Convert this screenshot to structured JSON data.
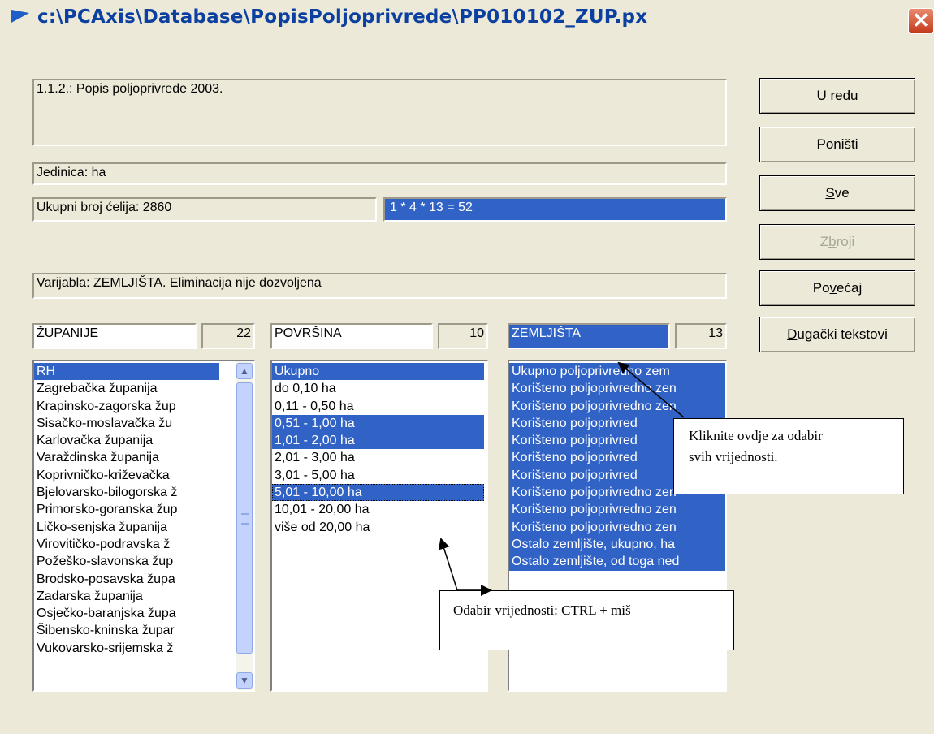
{
  "window": {
    "title": "c:\\PCAxis\\Database\\PopisPoljoprivrede\\PP010102_ZUP.px",
    "close_symbol": "✕",
    "title_icon": "arrow-icon"
  },
  "info": {
    "description": "1.1.2.: Popis poljoprivrede  2003.",
    "unit": "Jedinica: ha",
    "total_cells": "Ukupni broj ćelija:  2860",
    "selection_formula": "1 * 4 * 13 = 52",
    "variable_info": "Varijabla: ZEMLJIŠTA. Eliminacija nije dozvoljena"
  },
  "buttons": {
    "ok": "U redu",
    "cancel": "Poništi",
    "all_prefix": "",
    "all_underline": "S",
    "all_rest": "ve",
    "sum_prefix": "Z",
    "sum_underline": "b",
    "sum_rest": "roji",
    "enlarge_prefix": "Po",
    "enlarge_underline": "v",
    "enlarge_rest": "ećaj",
    "long_prefix": "",
    "long_underline": "D",
    "long_rest": "ugački tekstovi"
  },
  "variables": [
    {
      "name": "ŽUPANIJE",
      "count": "22",
      "values": [
        "RH",
        "Zagrebačka županija",
        "Krapinsko-zagorska žup",
        "Sisačko-moslavačka žu",
        "Karlovačka  županija",
        "Varaždinska županija",
        "Koprivničko-križevačka",
        "Bjelovarsko-bilogorska ž",
        "Primorsko-goranska žup",
        "Ličko-senjska županija",
        "Virovitičko-podravska ž",
        "Požeško-slavonska  žup",
        "Brodsko-posavska  župa",
        "Zadarska županija",
        "Osječko-baranjska župa",
        "Šibensko-kninska župar",
        "Vukovarsko-srijemska ž"
      ]
    },
    {
      "name": "POVRŠINA",
      "count": "10",
      "values": [
        "Ukupno",
        "do 0,10 ha",
        "0,11 - 0,50 ha",
        "0,51 - 1,00 ha",
        "1,01 - 2,00 ha",
        "2,01 - 3,00 ha",
        "3,01 - 5,00 ha",
        "5,01 - 10,00 ha",
        "10,01 - 20,00 ha",
        "više od 20,00 ha"
      ]
    },
    {
      "name": "ZEMLJIŠTA",
      "count": "13",
      "values": [
        "Ukupno poljoprivredno zem",
        "Korišteno poljoprivredno zen",
        "Korišteno poljoprivredno zen",
        "Korišteno poljoprivred",
        "Korišteno poljoprivred",
        "Korišteno poljoprivred",
        "Korišteno poljoprivred",
        "Korišteno poljoprivredno zen",
        "Korišteno poljoprivredno zen",
        "Korišteno poljoprivredno zen",
        "Ostalo zemljište, ukupno, ha",
        "Ostalo zemljište, od toga ned"
      ]
    }
  ],
  "callouts": {
    "select_all_line1": "Kliknite ovdje za odabir",
    "select_all_line2": "svih vrijednosti.",
    "select_values": "Odabir vrijednosti: CTRL + miš"
  },
  "scrollbar": {
    "up_icon": "▲",
    "down_icon": "▼"
  },
  "colors": {
    "selection": "#3163C6",
    "title_text": "#0B3FA0",
    "window_bg": "#ECE9D8"
  }
}
